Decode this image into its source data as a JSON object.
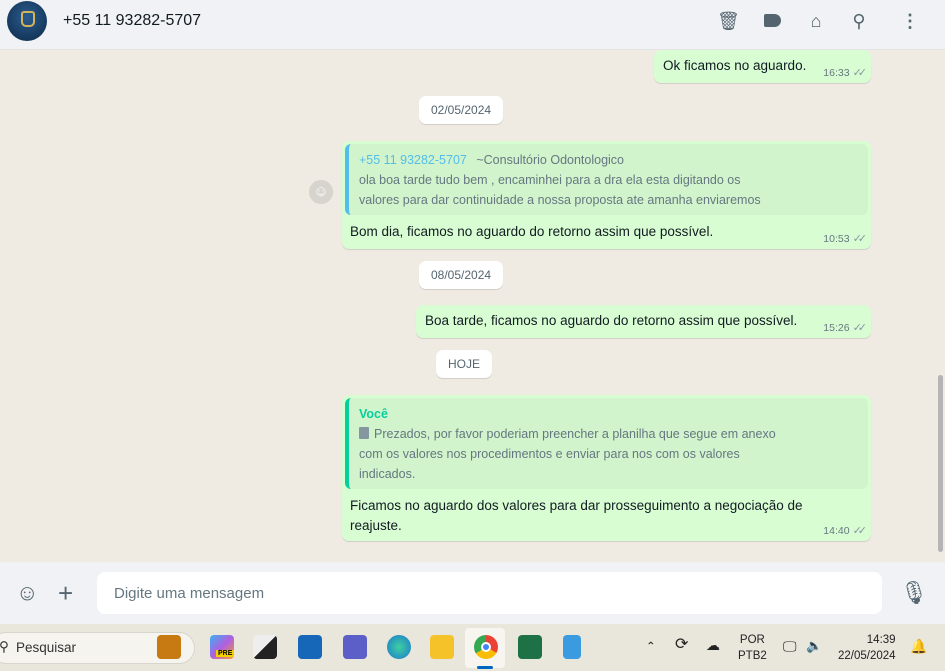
{
  "header": {
    "contact": "+55 11 93282-5707",
    "icons": [
      "delete-icon",
      "label-icon",
      "catalog-icon",
      "search-icon",
      "menu-icon"
    ]
  },
  "messages": [
    {
      "text": "Ok ficamos no aguardo.",
      "time": "16:33"
    },
    {
      "date": "02/05/2024"
    },
    {
      "quote_author": "+55 11 93282-5707",
      "quote_name": "~Consultório Odontologico",
      "quote_text": "ola boa tarde tudo bem , encaminhei para a dra ela esta digitando os valores para dar continuidade a nossa proposta ate amanha enviaremos",
      "text": "Bom dia, ficamos no aguardo do retorno assim que possível.",
      "time": "10:53"
    },
    {
      "date": "08/05/2024"
    },
    {
      "text": "Boa tarde, ficamos no aguardo do retorno assim que possível.",
      "time": "15:26"
    },
    {
      "date": "HOJE"
    },
    {
      "quote_author": "Você",
      "quote_text": "Prezados, por favor poderiam preencher a planilha que segue em anexo com os valores nos procedimentos e enviar para nos com os valores indicados.",
      "text": "Ficamos no aguardo dos valores para dar prosseguimento a negociação de reajuste.",
      "time": "14:40"
    }
  ],
  "footer": {
    "placeholder": "Digite uma mensagem"
  },
  "taskbar": {
    "search": "Pesquisar",
    "lang1": "POR",
    "lang2": "PTB2",
    "time": "14:39",
    "date": "22/05/2024",
    "copilot_badge": "PRE"
  },
  "colors": {
    "bubble": "#d9fdd3",
    "quote_blue": "#53bdeb",
    "quote_green": "#06cf9c"
  }
}
